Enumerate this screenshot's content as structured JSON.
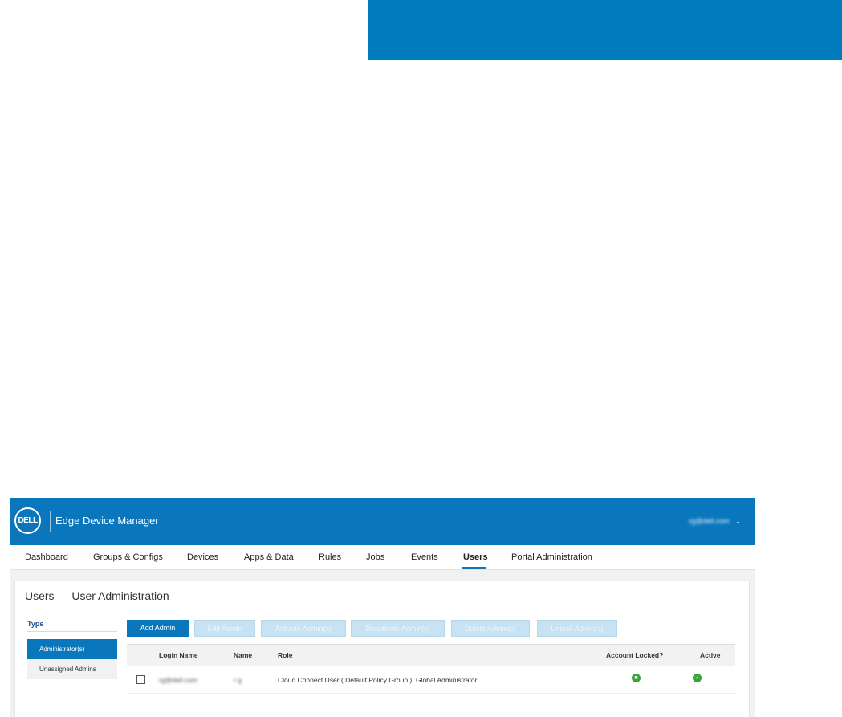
{
  "colors": {
    "brand_blue": "#0a77bd",
    "banner_blue": "#007bbd",
    "success_green": "#3aa33a"
  },
  "header": {
    "logo_text": "DELL",
    "app_title": "Edge Device Manager",
    "user_email": "rg@dell.com",
    "user_menu_icon": "chevron-down-icon"
  },
  "nav": {
    "items": [
      "Dashboard",
      "Groups & Configs",
      "Devices",
      "Apps & Data",
      "Rules",
      "Jobs",
      "Events",
      "Users",
      "Portal Administration"
    ],
    "active": "Users"
  },
  "page": {
    "title": "Users — User Administration"
  },
  "type_panel": {
    "label": "Type",
    "items": [
      "Administrator(s)",
      "Unassigned Admins"
    ],
    "selected": "Administrator(s)"
  },
  "toolbar": {
    "add_admin": "Add Admin",
    "edit_admin": "Edit Admin",
    "activate": "Activate Admin(s)",
    "deactivate": "Deactivate Admin(s)",
    "delete": "Delete Admin(s)",
    "unlock": "Unlock Admin(s)"
  },
  "table": {
    "columns": [
      "Login Name",
      "Name",
      "Role",
      "Account Locked?",
      "Active"
    ],
    "rows": [
      {
        "login_name": "rg@dell.com",
        "name": "r g",
        "role": "Cloud Connect User ( Default Policy Group ), Global Administrator",
        "account_locked_icon": "unlocked-icon",
        "active_icon": "check-circle-icon"
      }
    ]
  }
}
